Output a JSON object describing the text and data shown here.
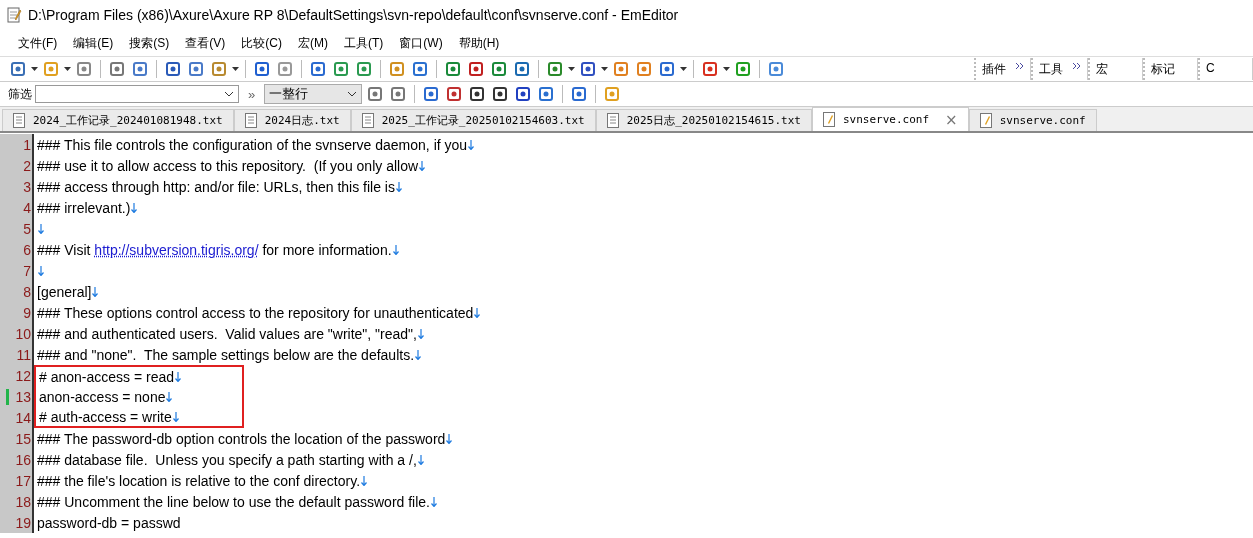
{
  "window": {
    "title": "D:\\Program Files (x86)\\Axure\\Axure RP 8\\DefaultSettings\\svn-repo\\default\\conf\\svnserve.conf - EmEditor"
  },
  "menu": [
    "文件(F)",
    "编辑(E)",
    "搜索(S)",
    "查看(V)",
    "比较(C)",
    "宏(M)",
    "工具(T)",
    "窗口(W)",
    "帮助(H)"
  ],
  "toolbar_panels": [
    {
      "label": "插件",
      "more": true
    },
    {
      "label": "工具",
      "more": true
    },
    {
      "label": "宏",
      "more": false
    },
    {
      "label": "标记",
      "more": false
    },
    {
      "label": "C",
      "more": false
    }
  ],
  "filter_bar": {
    "label": "筛选",
    "more": "»",
    "mode": "一整行"
  },
  "tabs": [
    {
      "label": "2024_工作记录_202401081948.txt",
      "kind": "text",
      "selected": false
    },
    {
      "label": "2024日志.txt",
      "kind": "text",
      "selected": false
    },
    {
      "label": "2025_工作记录_20250102154603.txt",
      "kind": "text",
      "selected": false
    },
    {
      "label": "2025日志_20250102154615.txt",
      "kind": "text",
      "selected": false
    },
    {
      "label": "svnserve.conf",
      "kind": "conf",
      "selected": true
    },
    {
      "label": "svnserve.conf",
      "kind": "conf",
      "selected": false
    }
  ],
  "close_tab": "×",
  "lines": [
    {
      "number": "1",
      "text": "### This file controls the configuration of the svnserve daemon, if you",
      "modified": false
    },
    {
      "number": "2",
      "text": "### use it to allow access to this repository.  (If you only allow",
      "modified": false
    },
    {
      "number": "3",
      "text": "### access through http: and/or file: URLs, then this file is",
      "modified": false
    },
    {
      "number": "4",
      "text": "### irrelevant.)",
      "modified": false
    },
    {
      "number": "5",
      "modified": false
    },
    {
      "number": "6",
      "segments": [
        {
          "kind": "text",
          "text": "### Visit "
        },
        {
          "kind": "link",
          "text": "http://subversion.tigris.org/"
        },
        {
          "kind": "text",
          "text": " for more information."
        }
      ],
      "modified": false
    },
    {
      "number": "7",
      "modified": false
    },
    {
      "number": "8",
      "text": "[general]",
      "modified": false
    },
    {
      "number": "9",
      "text": "### These options control access to the repository for unauthenticated",
      "modified": false
    },
    {
      "number": "10",
      "text": "### and authenticated users.  Valid values are \"write\", \"read\",",
      "modified": false
    },
    {
      "number": "11",
      "text": "### and \"none\".  The sample settings below are the defaults.",
      "modified": false
    },
    {
      "number": "12",
      "text": "# anon-access = read",
      "modified": false,
      "highlighted": true
    },
    {
      "number": "13",
      "text": "anon-access = none",
      "modified": true,
      "highlighted": true
    },
    {
      "number": "14",
      "text": "# auth-access = write",
      "modified": false,
      "highlighted": true
    },
    {
      "number": "15",
      "text": "### The password-db option controls the location of the password",
      "modified": false
    },
    {
      "number": "16",
      "text": "### database file.  Unless you specify a path starting with a /,",
      "modified": false
    },
    {
      "number": "17",
      "text": "### the file's location is relative to the conf directory.",
      "modified": false
    },
    {
      "number": "18",
      "text": "### Uncomment the line below to use the default password file.",
      "modified": false
    },
    {
      "number": "19",
      "text": "password-db = passwd",
      "modified": false
    }
  ]
}
